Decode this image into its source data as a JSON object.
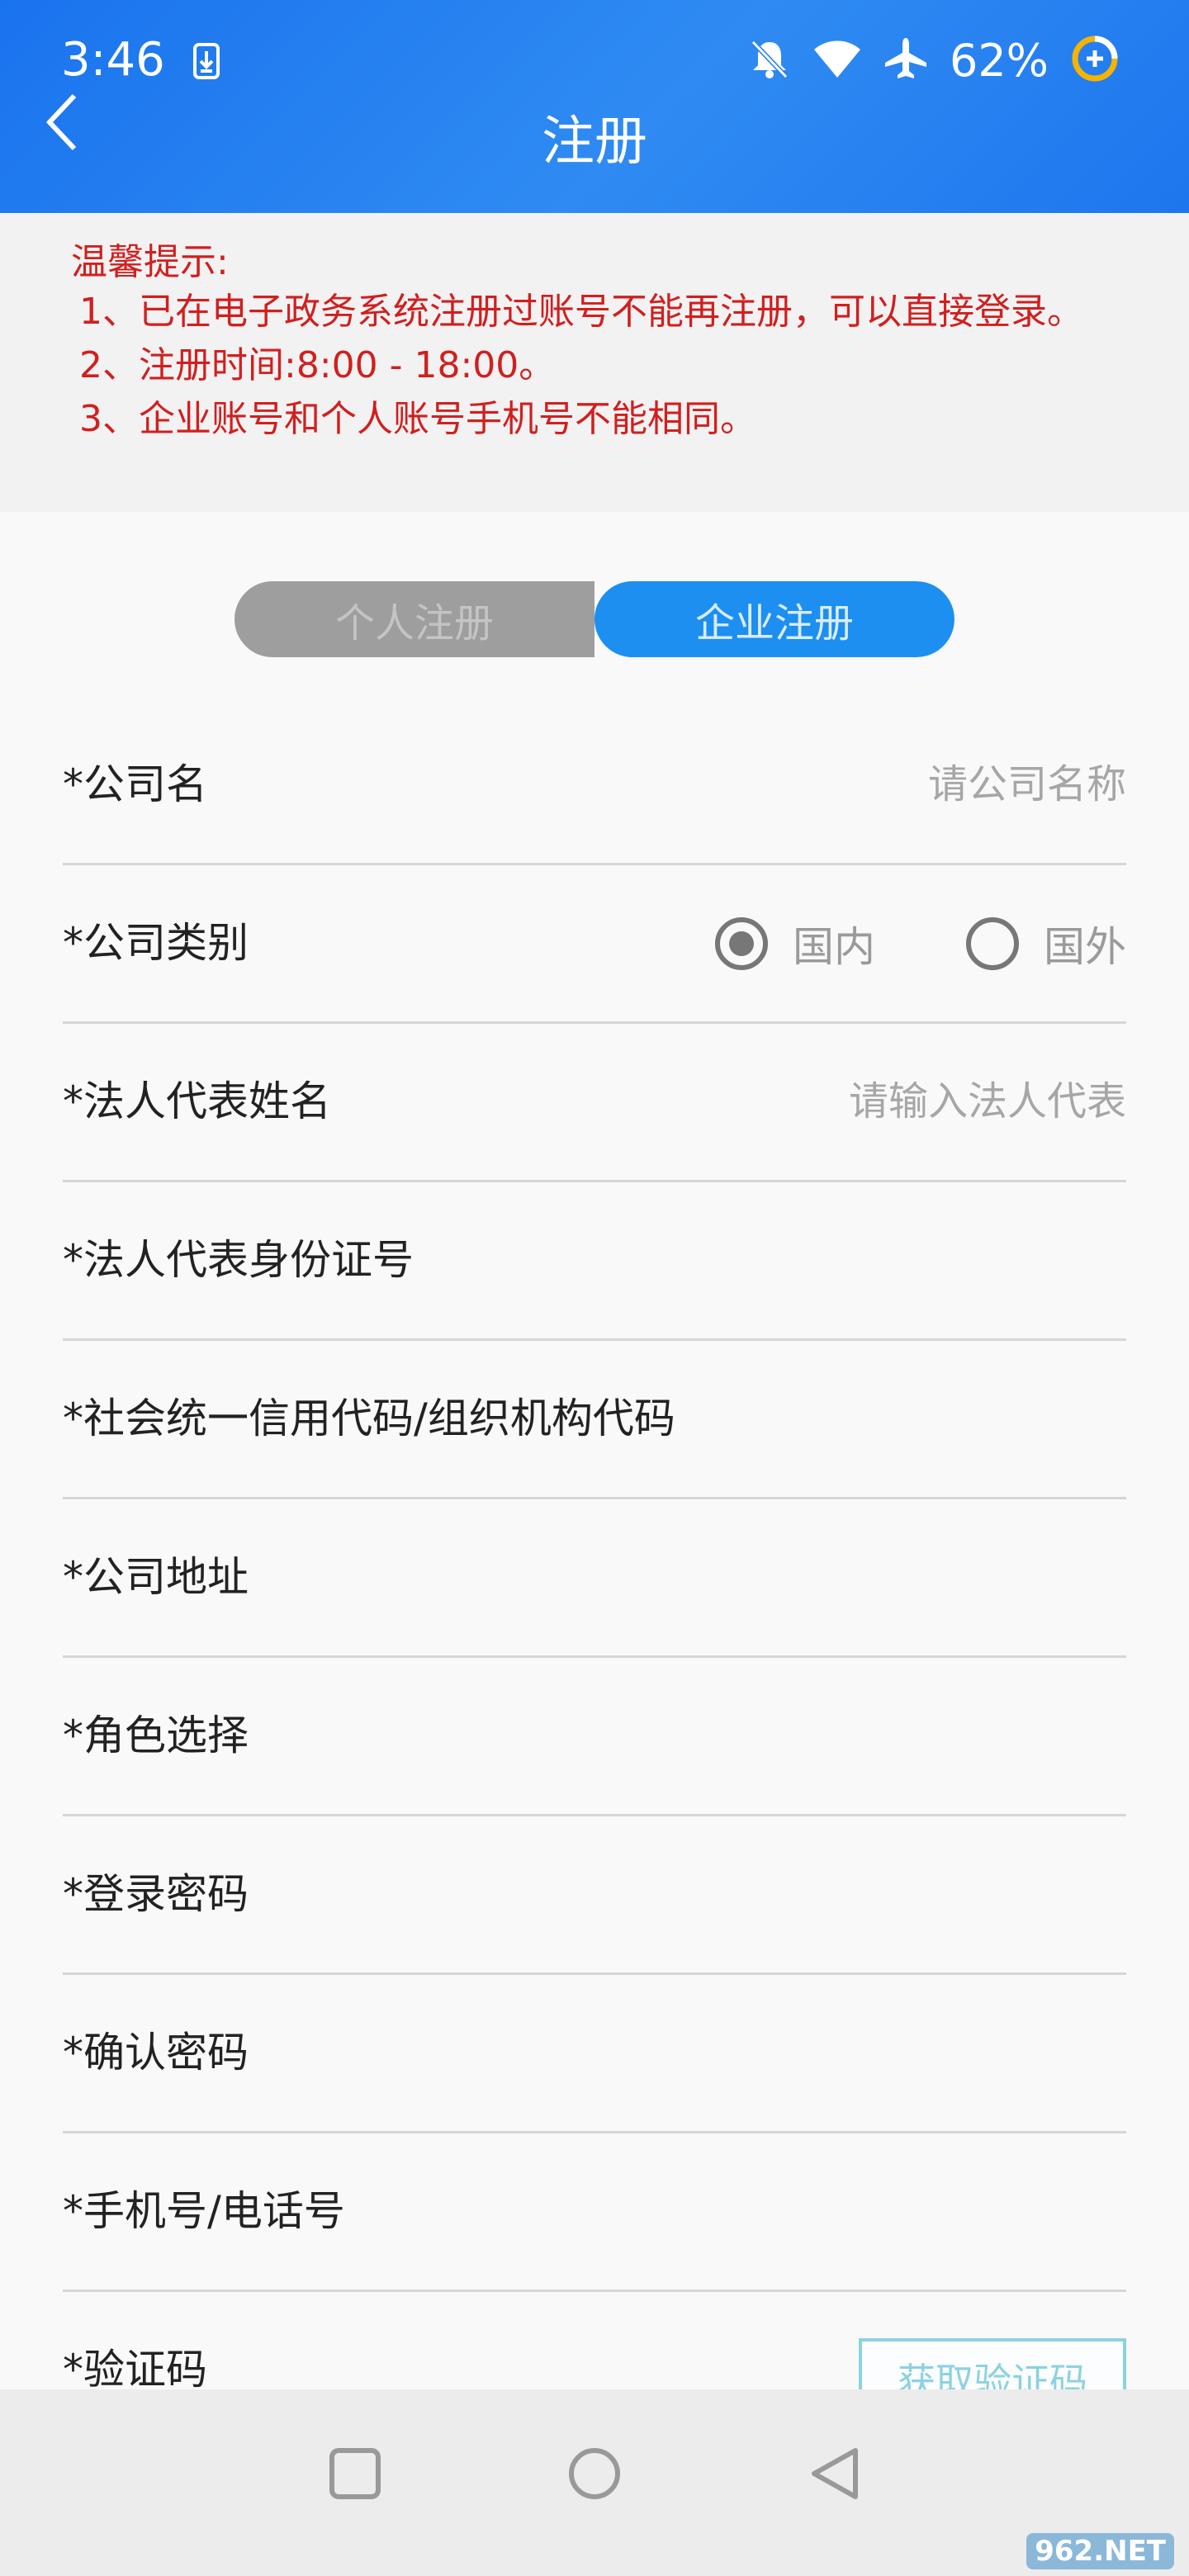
{
  "status_bar": {
    "time": "3:46",
    "battery": "62%"
  },
  "header": {
    "title": "注册"
  },
  "notice": {
    "title": "温馨提示:",
    "lines": [
      "1、已在电子政务系统注册过账号不能再注册，可以直接登录。",
      "2、注册时间:8:00 - 18:00。",
      "3、企业账号和个人账号手机号不能相同。"
    ]
  },
  "tabs": {
    "personal": "个人注册",
    "company": "企业注册",
    "selected": "company"
  },
  "form": {
    "company_name": {
      "label": "*公司名",
      "placeholder": "请公司名称"
    },
    "company_type": {
      "label": "*公司类别",
      "domestic": "国内",
      "foreign": "国外",
      "selected": "domestic"
    },
    "legal_rep_name": {
      "label": "*法人代表姓名",
      "placeholder": "请输入法人代表"
    },
    "legal_rep_id": {
      "label": "*法人代表身份证号"
    },
    "credit_code": {
      "label": "*社会统一信用代码/组织机构代码"
    },
    "address": {
      "label": "*公司地址"
    },
    "role": {
      "label": "*角色选择"
    },
    "password": {
      "label": "*登录密码"
    },
    "confirm_password": {
      "label": "*确认密码"
    },
    "phone": {
      "label": "*手机号/电话号"
    },
    "verify_code": {
      "label": "*验证码",
      "button": "获取验证码"
    }
  },
  "watermark": "962.NET",
  "colors": {
    "header": "#1a73ee",
    "notice_text": "#d11f1f",
    "tab_active": "#1c8ff0",
    "code_button": "#8ed2e0"
  }
}
